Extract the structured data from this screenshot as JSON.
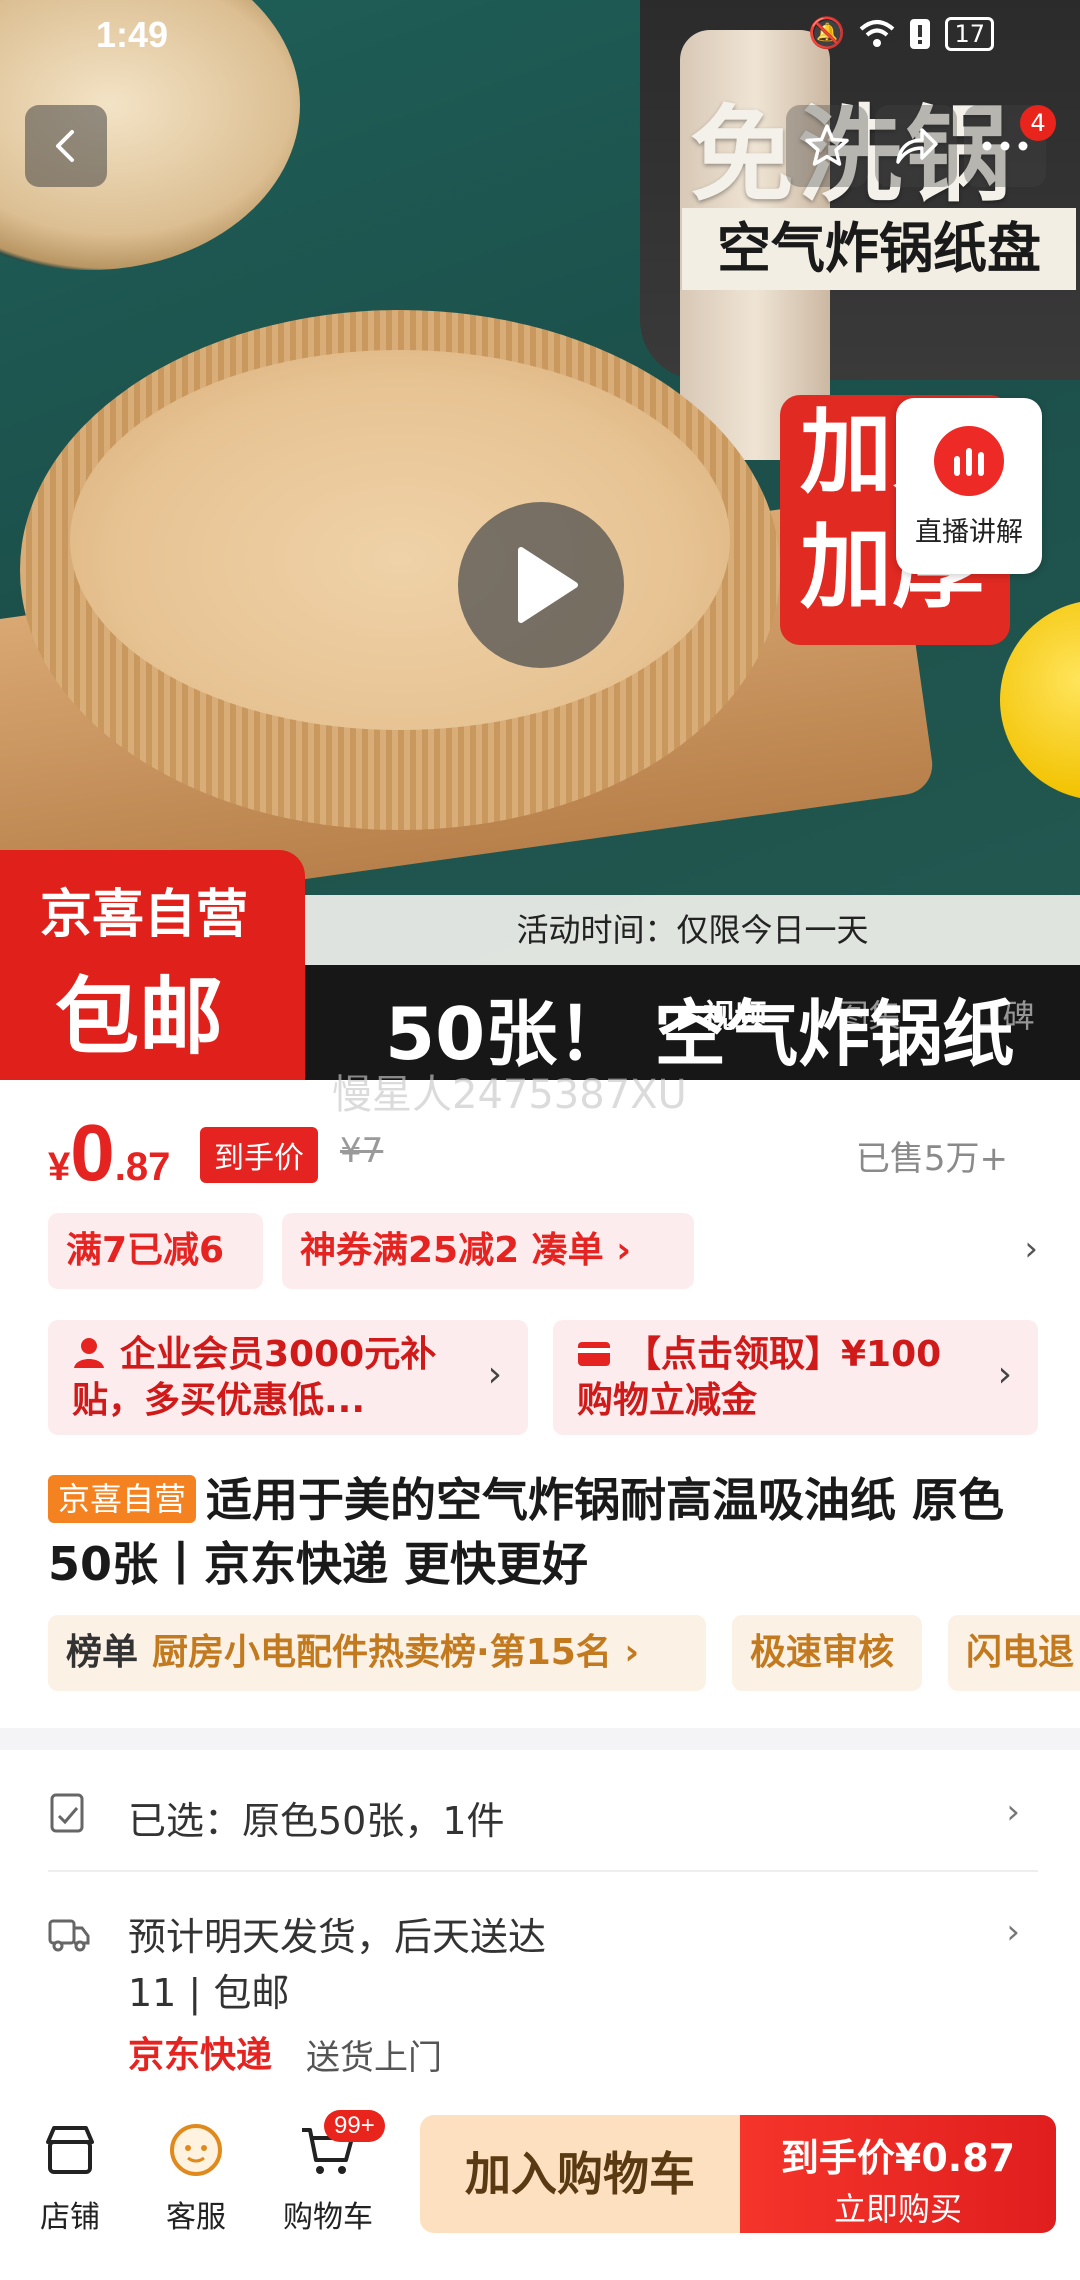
{
  "status_bar": {
    "time": "1:49",
    "battery": "17"
  },
  "hero": {
    "headline": "免洗锅",
    "subtitle": "空气炸锅纸盘",
    "badge_line1": "加大",
    "badge_line2": "加厚",
    "jd_badge_line1": "京喜自营",
    "jd_badge_line2": "包邮",
    "activity": "活动时间：仅限今日一天",
    "big_text": "50张！ 空气炸锅纸",
    "live_label": "直播讲解",
    "more_badge": "4",
    "media_tabs": [
      "视频",
      "图集",
      "口碑"
    ],
    "watermark": "慢星人2475387XU"
  },
  "price": {
    "currency": "¥",
    "integer": "0",
    "decimal": ".87",
    "tag": "到手价",
    "original": "¥7",
    "sold": "已售5万+"
  },
  "coupons": [
    "满7已减6",
    "神券满25减2  凑单 ›"
  ],
  "promos": [
    {
      "icon": "person-icon",
      "text": "企业会员3000元补贴，多买优惠低..."
    },
    {
      "icon": "card-icon",
      "text": "【点击领取】¥100购物立减金"
    }
  ],
  "product": {
    "tag": "京喜自营",
    "title": "适用于美的空气炸锅耐高温吸油纸 原色50张丨京东快递 更快更好"
  },
  "ranks": {
    "label": "榜单",
    "rank_text": "厨房小电配件热卖榜·第15名 ›",
    "tag2": "极速审核",
    "tag3": "闪电退"
  },
  "selected": "已选：原色50张，1件",
  "shipping": {
    "line1": "预计明天发货，后天送达",
    "line2": "11 | 包邮",
    "express": "京东快递",
    "door": "送货上门"
  },
  "bottom_bar": {
    "store": "店铺",
    "service": "客服",
    "cart": "购物车",
    "cart_badge": "99+",
    "add_to_cart": "加入购物车",
    "buy_price": "到手价¥0.87",
    "buy_now": "立即购买"
  },
  "colors": {
    "accent": "#e52421",
    "orange": "#f58220"
  }
}
